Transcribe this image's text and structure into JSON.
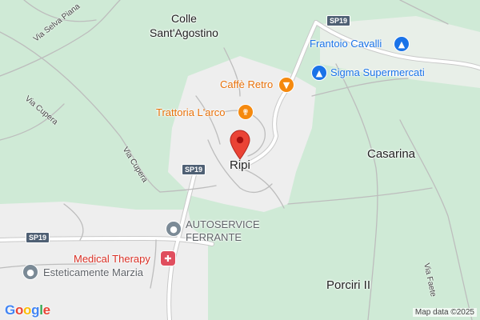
{
  "map": {
    "style": {
      "forest_color": "#cfead6",
      "urban_color": "#eeeeee",
      "road_color": "#ffffff",
      "road_outline": "#c5c5c5",
      "pin_color": "#ea4335"
    },
    "places": {
      "colle_line1": "Colle",
      "colle_line2": "Sant'Agostino",
      "ripi": "Ripi",
      "casarina": "Casarina",
      "porciri": "Porciri II"
    },
    "roads": {
      "via_selva_piana": "Via Selva Piana",
      "via_cupera_1": "Via Cupera",
      "via_cupera_2": "Via Cupera",
      "via_faete": "Via Faete",
      "sp19_top": "SP19",
      "sp19_mid": "SP19",
      "sp19_left": "SP19"
    },
    "pois": {
      "frantoio": {
        "label": "Frantoio Cavalli",
        "icon": "shopping-bag-icon"
      },
      "caffe": {
        "label": "Caffè Retro",
        "icon": "cocktail-icon"
      },
      "sigma": {
        "label": "Sigma Supermercati",
        "icon": "shopping-cart-icon"
      },
      "trattoria": {
        "label": "Trattoria L'arco",
        "icon": "fork-knife-icon"
      },
      "autoservice_line1": "AUTOSERVICE",
      "autoservice_line2": "FERRANTE",
      "autoservice_icon": "dot-icon",
      "medical": {
        "label": "Medical Therapy",
        "icon": "medical-cross-icon"
      },
      "estetica": {
        "label": "Esteticamente Marzia",
        "icon": "dot-icon"
      }
    },
    "attribution": {
      "logo": "Google",
      "copyright": "Map data ©2025"
    }
  }
}
